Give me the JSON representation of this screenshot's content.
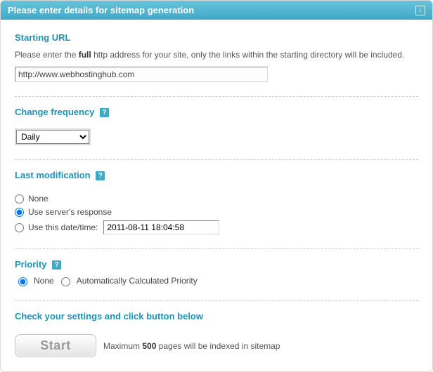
{
  "panel": {
    "title": "Please enter details for sitemap generation"
  },
  "startingUrl": {
    "heading": "Starting URL",
    "desc_pre": "Please enter the ",
    "desc_bold": "full",
    "desc_post": " http address for your site, only the links within the starting directory will be included.",
    "value": "http://www.webhostinghub.com"
  },
  "frequency": {
    "heading": "Change frequency",
    "help": "?",
    "selected": "Daily"
  },
  "lastMod": {
    "heading": "Last modification",
    "help": "?",
    "options": {
      "none": "None",
      "server": "Use server's response",
      "date": "Use this date/time:"
    },
    "selected": "server",
    "dateValue": "2011-08-11 18:04:58"
  },
  "priority": {
    "heading": "Priority",
    "help": "?",
    "options": {
      "none": "None",
      "auto": "Automatically Calculated Priority"
    },
    "selected": "none"
  },
  "start": {
    "heading": "Check your settings and click button below",
    "button": "Start",
    "note_pre": "Maximum ",
    "note_bold": "500",
    "note_post": " pages will be indexed in sitemap"
  }
}
